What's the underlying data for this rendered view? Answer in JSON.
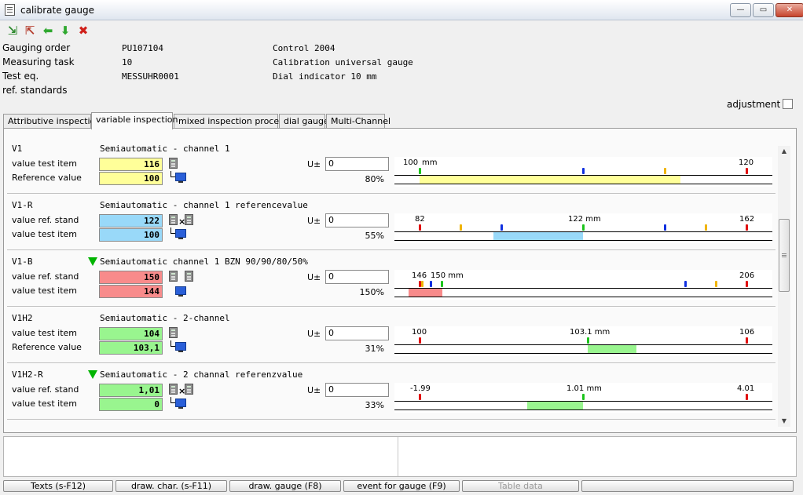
{
  "window": {
    "title": "calibrate gauge"
  },
  "colors": {
    "yellow": "#ffff99",
    "blue": "#99d9f9",
    "red": "#f88b8b",
    "green": "#99f58f"
  },
  "header": {
    "gauging_order": {
      "label": "Gauging order",
      "value": "PU107104",
      "extra": "Control 2004"
    },
    "measuring_task": {
      "label": "Measuring task",
      "value": "10",
      "extra": "Calibration universal gauge"
    },
    "test_eq": {
      "label": "Test eq.",
      "value": "MESSUHR0001",
      "extra": "Dial indicator 10 mm"
    },
    "ref_standards": {
      "label": "ref. standards"
    },
    "adjustment_label": "adjustment"
  },
  "tabs": [
    "Attributive inspection",
    "variable inspection",
    "mixed inspection process",
    "dial gauge",
    "Multi-Channel"
  ],
  "u_label": "U±",
  "rows": [
    {
      "code": "V1",
      "desc": "Semiautomatic - channel 1",
      "label1": "value test item",
      "value1": "116",
      "label2": "Reference value",
      "value2": "100",
      "u": "0",
      "pct": "80%",
      "gauge": {
        "left": "100",
        "mid": "mm",
        "right": "120"
      }
    },
    {
      "code": "V1-R",
      "desc": "Semiautomatic - channel 1 referencevalue",
      "label1": "value ref. stand",
      "value1": "122",
      "label2": "value test item",
      "value2": "100",
      "u": "0",
      "pct": "55%",
      "gauge": {
        "left": "82",
        "mid": "122 mm",
        "right": "162"
      }
    },
    {
      "code": "V1-B",
      "desc": "Semiautomatic channel 1 BZN 90/90/80/50%",
      "label1": "value ref. stand",
      "value1": "150",
      "label2": "value test item",
      "value2": "144",
      "u": "0",
      "pct": "150%",
      "gauge": {
        "left": "146",
        "mid": "150 mm",
        "right": "206"
      }
    },
    {
      "code": "V1H2",
      "desc": "Semiautomatic - 2-channel",
      "label1": "value test item",
      "value1": "104",
      "label2": "Reference value",
      "value2": "103,1",
      "u": "0",
      "pct": "31%",
      "gauge": {
        "left": "100",
        "mid": "103.1 mm",
        "right": "106"
      }
    },
    {
      "code": "V1H2-R",
      "desc": "Semiautomatic - 2 channal referenzvalue",
      "label1": "value ref. stand",
      "value1": "1,01",
      "label2": "value test item",
      "value2": "0",
      "u": "0",
      "pct": "33%",
      "gauge": {
        "left": "-1.99",
        "mid": "1.01 mm",
        "right": "4.01"
      }
    }
  ],
  "buttons": [
    "Texts (s-F12)",
    "draw. char. (s-F11)",
    "draw. gauge (F8)",
    "event for gauge (F9)",
    "Table data",
    ""
  ]
}
